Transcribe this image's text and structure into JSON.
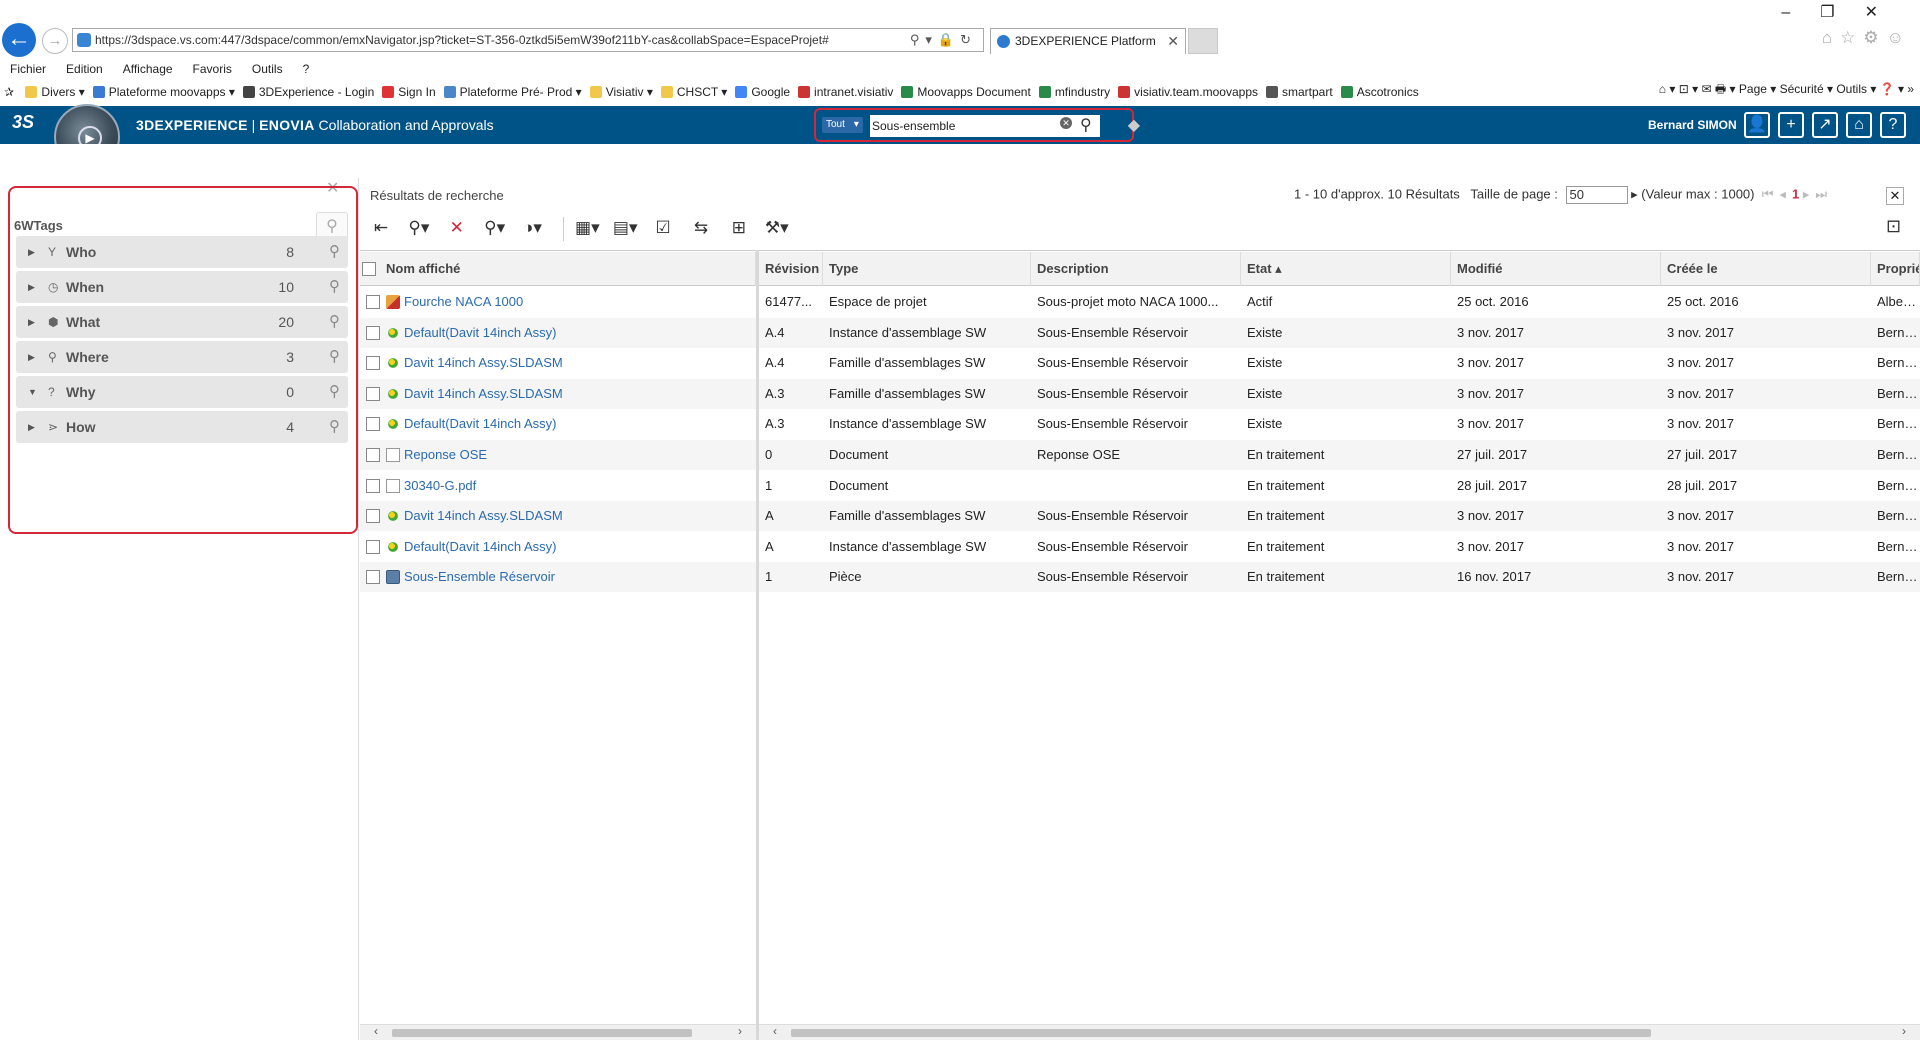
{
  "browser": {
    "url": "https://3dspace.vs.com:447/3dspace/common/emxNavigator.jsp?ticket=ST-356-0ztkd5i5emW39of211bY-cas&collabSpace=EspaceProjet#",
    "tab_title": "3DEXPERIENCE Platform",
    "menu": [
      "Fichier",
      "Edition",
      "Affichage",
      "Favoris",
      "Outils",
      "?"
    ],
    "favorites": [
      {
        "label": "Divers ▾",
        "color": "#f2c84b"
      },
      {
        "label": "Plateforme moovapps ▾",
        "color": "#3a7ad1"
      },
      {
        "label": "3DExperience - Login",
        "color": "#444"
      },
      {
        "label": "Sign In",
        "color": "#d33"
      },
      {
        "label": "Plateforme Pré- Prod ▾",
        "color": "#4a86c8"
      },
      {
        "label": "Visiativ ▾",
        "color": "#f2c84b"
      },
      {
        "label": "CHSCT ▾",
        "color": "#f2c84b"
      },
      {
        "label": "Google",
        "color": "#4285f4"
      },
      {
        "label": "intranet.visiativ",
        "color": "#c33"
      },
      {
        "label": "Moovapps Document",
        "color": "#2a8a4a"
      },
      {
        "label": "mfindustry",
        "color": "#2a8a4a"
      },
      {
        "label": "visiativ.team.moovapps",
        "color": "#c33"
      },
      {
        "label": "smartpart",
        "color": "#555"
      },
      {
        "label": "Ascotronics",
        "color": "#2a8a4a"
      }
    ],
    "right_tools": "⌂ ▾  ⊡ ▾  ✉  🖶 ▾  Page ▾  Sécurité ▾  Outils ▾  ❓ ▾  »"
  },
  "header": {
    "brand_bold": "3DEXPERIENCE",
    "brand_sep": " | ",
    "app_bold": "ENOVIA",
    "app_name": " Collaboration and Approvals",
    "search_scope": "Tout",
    "search_value": "Sous-ensemble",
    "user": "Bernard SIMON"
  },
  "tags_panel": {
    "title": "6WTags",
    "rows": [
      {
        "label": "Who",
        "count": "8",
        "icon": "Y",
        "expanded": false
      },
      {
        "label": "When",
        "count": "10",
        "icon": "◷",
        "expanded": false
      },
      {
        "label": "What",
        "count": "20",
        "icon": "⬢",
        "expanded": false
      },
      {
        "label": "Where",
        "count": "3",
        "icon": "⚲",
        "expanded": false
      },
      {
        "label": "Why",
        "count": "0",
        "icon": "?",
        "expanded": true
      },
      {
        "label": "How",
        "count": "4",
        "icon": "⋗",
        "expanded": false
      }
    ]
  },
  "results": {
    "title": "Résultats de recherche",
    "summary": "1 - 10 d'approx. 10 Résultats",
    "page_size_label": "Taille de page :",
    "page_size": "50",
    "max_label": "(Valeur max : 1000)",
    "current_page": "1",
    "columns": [
      "Nom affiché",
      "Révision",
      "Type",
      "Description",
      "Etat ▴",
      "Modifié",
      "Créée le",
      "Propriétaire"
    ],
    "rows": [
      {
        "name": "Fourche NACA 1000",
        "icon": "space",
        "rev": "61477...",
        "type": "Espace de projet",
        "desc": "Sous-projet moto NACA 1000...",
        "state": "Actif",
        "modified": "25 oct. 2016",
        "created": "25 oct. 2016",
        "owner": "Albert-E"
      },
      {
        "name": "Default(Davit 14inch Assy)",
        "icon": "asm",
        "rev": "A.4",
        "type": "Instance d'assemblage SW",
        "desc": "Sous-Ensemble Réservoir",
        "state": "Existe",
        "modified": "3 nov. 2017",
        "created": "3 nov. 2017",
        "owner": "Bernard"
      },
      {
        "name": "Davit 14inch Assy.SLDASM",
        "icon": "asm",
        "rev": "A.4",
        "type": "Famille d'assemblages SW",
        "desc": "Sous-Ensemble Réservoir",
        "state": "Existe",
        "modified": "3 nov. 2017",
        "created": "3 nov. 2017",
        "owner": "Bernard"
      },
      {
        "name": "Davit 14inch Assy.SLDASM",
        "icon": "asm",
        "rev": "A.3",
        "type": "Famille d'assemblages SW",
        "desc": "Sous-Ensemble Réservoir",
        "state": "Existe",
        "modified": "3 nov. 2017",
        "created": "3 nov. 2017",
        "owner": "Bernard"
      },
      {
        "name": "Default(Davit 14inch Assy)",
        "icon": "asm",
        "rev": "A.3",
        "type": "Instance d'assemblage SW",
        "desc": "Sous-Ensemble Réservoir",
        "state": "Existe",
        "modified": "3 nov. 2017",
        "created": "3 nov. 2017",
        "owner": "Bernard"
      },
      {
        "name": "Reponse OSE",
        "icon": "doc",
        "rev": "0",
        "type": "Document",
        "desc": "Reponse OSE",
        "state": "En traitement",
        "modified": "27 juil. 2017",
        "created": "27 juil. 2017",
        "owner": "Bernard"
      },
      {
        "name": "30340-G.pdf",
        "icon": "doc",
        "rev": "1",
        "type": "Document",
        "desc": "",
        "state": "En traitement",
        "modified": "28 juil. 2017",
        "created": "28 juil. 2017",
        "owner": "Bernard"
      },
      {
        "name": "Davit 14inch Assy.SLDASM",
        "icon": "asm",
        "rev": "A",
        "type": "Famille d'assemblages SW",
        "desc": "Sous-Ensemble Réservoir",
        "state": "En traitement",
        "modified": "3 nov. 2017",
        "created": "3 nov. 2017",
        "owner": "Bernard"
      },
      {
        "name": "Default(Davit 14inch Assy)",
        "icon": "asm",
        "rev": "A",
        "type": "Instance d'assemblage SW",
        "desc": "Sous-Ensemble Réservoir",
        "state": "En traitement",
        "modified": "3 nov. 2017",
        "created": "3 nov. 2017",
        "owner": "Bernard"
      },
      {
        "name": "Sous-Ensemble Réservoir",
        "icon": "part",
        "rev": "1",
        "type": "Pièce",
        "desc": "Sous-Ensemble Réservoir",
        "state": "En traitement",
        "modified": "16 nov. 2017",
        "created": "3 nov. 2017",
        "owner": "Bernard"
      }
    ]
  },
  "colors": {
    "header_bg": "#005386",
    "highlight_border": "#d3283a",
    "link": "#2a6ab1"
  }
}
